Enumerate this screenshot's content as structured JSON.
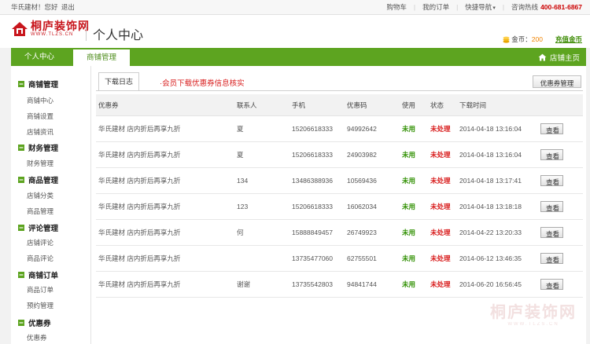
{
  "topbar": {
    "welcome": "华氏建材！您好",
    "logout": "退出",
    "cart": "购物车",
    "orders": "我的订单",
    "quicknav": "快捷导航",
    "hotline_label": "咨询热线",
    "hotline_number": "400-681-6867"
  },
  "header": {
    "logo_cn": "桐庐装饰网",
    "logo_en": "WWW.TLZS.CN",
    "page_title": "个人中心",
    "coins_label": "金币：",
    "coins_value": "200",
    "recharge": "充值金币"
  },
  "nav": {
    "tab_personal": "个人中心",
    "tab_shop": "商铺管理",
    "shop_home": "店铺主页"
  },
  "sidebar": {
    "groups": [
      {
        "title": "商铺管理",
        "items": [
          "商铺中心",
          "商铺设置",
          "店铺资讯"
        ]
      },
      {
        "title": "财务管理",
        "items": [
          "财务管理"
        ]
      },
      {
        "title": "商品管理",
        "items": [
          "店铺分类",
          "商品管理"
        ]
      },
      {
        "title": "评论管理",
        "items": [
          "店铺评论",
          "商品评论"
        ]
      },
      {
        "title": "商铺订单",
        "items": [
          "商品订单",
          "预约管理"
        ]
      },
      {
        "title": "优惠券",
        "items": [
          "优惠券"
        ]
      }
    ]
  },
  "content": {
    "tab_label": "下载日志",
    "note": "·会员下载优惠券信息核实",
    "coupon_btn": "优惠券管理",
    "headers": [
      "优惠券",
      "联系人",
      "手机",
      "优惠码",
      "使用",
      "状态",
      "下载时间"
    ],
    "view_label": "查看",
    "rows": [
      {
        "coupon": "华氏建材 店内折后再享九折",
        "contact": "夏",
        "phone": "15206618333",
        "code": "94992642",
        "used": "未用",
        "status": "未处理",
        "time": "2014-04-18 13:16:04"
      },
      {
        "coupon": "华氏建材 店内折后再享九折",
        "contact": "夏",
        "phone": "15206618333",
        "code": "24903982",
        "used": "未用",
        "status": "未处理",
        "time": "2014-04-18 13:16:04"
      },
      {
        "coupon": "华氏建材 店内折后再享九折",
        "contact": "134",
        "phone": "13486388936",
        "code": "10569436",
        "used": "未用",
        "status": "未处理",
        "time": "2014-04-18 13:17:41"
      },
      {
        "coupon": "华氏建材 店内折后再享九折",
        "contact": "123",
        "phone": "15206618333",
        "code": "16062034",
        "used": "未用",
        "status": "未处理",
        "time": "2014-04-18 13:18:18"
      },
      {
        "coupon": "华氏建材 店内折后再享九折",
        "contact": "何",
        "phone": "15888849457",
        "code": "26749923",
        "used": "未用",
        "status": "未处理",
        "time": "2014-04-22 13:20:33"
      },
      {
        "coupon": "华氏建材 店内折后再享九折",
        "contact": "",
        "phone": "13735477060",
        "code": "62755501",
        "used": "未用",
        "status": "未处理",
        "time": "2014-06-12 13:46:35"
      },
      {
        "coupon": "华氏建材 店内折后再享九折",
        "contact": "谢谢",
        "phone": "13735542803",
        "code": "94841744",
        "used": "未用",
        "status": "未处理",
        "time": "2014-06-20 16:56:45"
      }
    ]
  },
  "watermark": {
    "cn": "桐庐装饰网",
    "en": "WWW.TLZS.CN"
  },
  "colors": {
    "brand_green": "#5da420",
    "accent_red": "#c8161d",
    "used_green": "#2f8f00",
    "status_red": "#d81c1c",
    "coin_orange": "#f08300"
  }
}
